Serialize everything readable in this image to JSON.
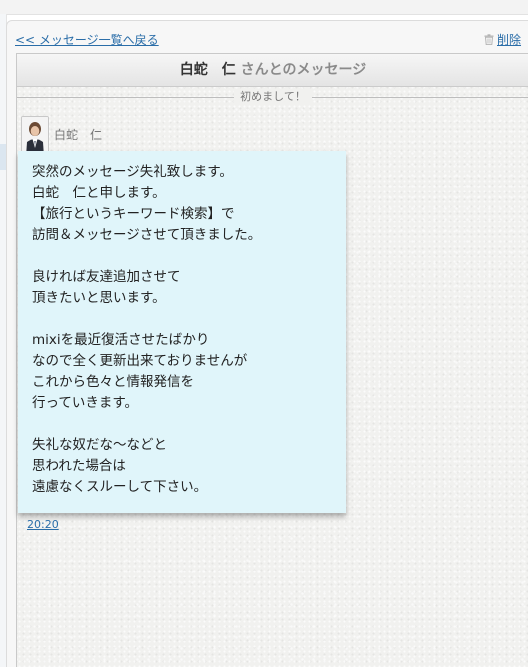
{
  "nav": {
    "back_link": "<< メッセージ一覧へ戻る",
    "delete_link": "削除"
  },
  "thread": {
    "partner_name": "白蛇　仁",
    "header_suffix": "さんとのメッセージ",
    "subject": "初めまして！"
  },
  "message": {
    "sender_name": "白蛇　仁",
    "lines": [
      "突然のメッセージ失礼致します。",
      "白蛇　仁と申します。",
      "【旅行というキーワード検索】で",
      "訪問＆メッセージさせて頂きました。",
      "良ければ友達追加させて",
      "頂きたいと思います。",
      "mixiを最近復活させたばかり",
      "なので全く更新出来ておりませんが",
      "これから色々と情報発信を",
      "行っていきます。",
      "失礼な奴だな〜などと",
      "思われた場合は",
      "遠慮なくスルーして下さい。"
    ],
    "time": "20:20"
  },
  "icons": {
    "trash": "trash-icon",
    "avatar": "avatar-photo"
  },
  "colors": {
    "link": "#2a6da8",
    "bubble": "#e0f5fa",
    "header_gray": "#8a8a8a"
  }
}
